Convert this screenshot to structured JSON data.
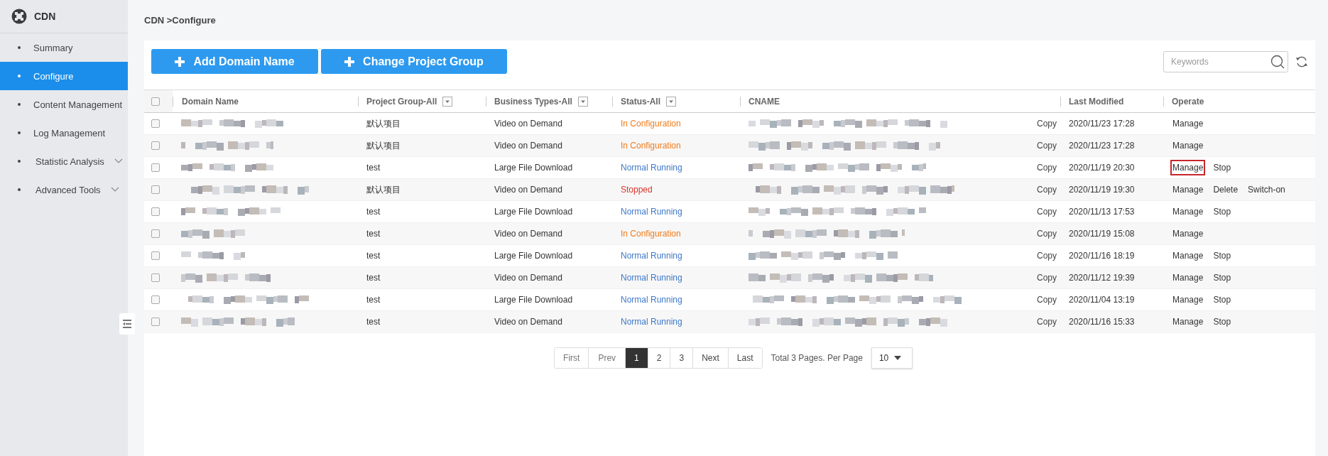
{
  "sidebar": {
    "title": "CDN",
    "items": [
      {
        "label": "Summary",
        "selected": false
      },
      {
        "label": "Configure",
        "selected": true
      },
      {
        "label": "Content Management",
        "selected": false
      },
      {
        "label": "Log Management",
        "selected": false
      },
      {
        "label": "Statistic Analysis",
        "selected": false,
        "expanded": false
      },
      {
        "label": "Advanced Tools",
        "selected": false,
        "expanded": false
      }
    ]
  },
  "breadcrumb": "CDN >Configure",
  "toolbar": {
    "buttons": [
      "Add Domain Name",
      "Change Project Group"
    ],
    "search": {
      "placeholder": "Keywords"
    }
  },
  "table": {
    "select_all_checked": false,
    "columns": [
      {
        "label": "Domain Name",
        "filter": false
      },
      {
        "label": "Project Group-All",
        "filter": true
      },
      {
        "label": "Business Types-All",
        "filter": true
      },
      {
        "label": "Status-All",
        "filter": true
      },
      {
        "label": "CNAME",
        "filter": false
      },
      {
        "label": "Last Modified",
        "filter": false
      },
      {
        "label": "Operate",
        "filter": false
      }
    ],
    "rows": [
      {
        "checked": false,
        "project": "默认项目",
        "business": "Video on Demand",
        "status": "In Configuration",
        "color": "#f07c1e",
        "copy": "Copy",
        "modified": "2020/11/23 17:28",
        "actions": [
          {
            "label": "Manage",
            "highlighted": false
          }
        ]
      },
      {
        "checked": false,
        "project": "默认项目",
        "business": "Video on Demand",
        "status": "In Configuration",
        "color": "#f07c1e",
        "copy": "Copy",
        "modified": "2020/11/23 17:28",
        "actions": [
          {
            "label": "Manage",
            "highlighted": false
          }
        ]
      },
      {
        "checked": false,
        "project": "test",
        "business": "Large File Download",
        "status": "Normal Running",
        "color": "#3e79c9",
        "copy": "Copy",
        "modified": "2020/11/19 20:30",
        "actions": [
          {
            "label": "Manage",
            "highlighted": true
          },
          {
            "label": "Stop",
            "highlighted": false
          }
        ]
      },
      {
        "checked": false,
        "project": "默认项目",
        "business": "Video on Demand",
        "status": "Stopped",
        "color": "#d9342b",
        "copy": "Copy",
        "modified": "2020/11/19 19:30",
        "actions": [
          {
            "label": "Manage",
            "highlighted": false
          },
          {
            "label": "Delete",
            "highlighted": false
          },
          {
            "label": "Switch-on",
            "highlighted": false
          }
        ]
      },
      {
        "checked": false,
        "project": "test",
        "business": "Large File Download",
        "status": "Normal Running",
        "color": "#3e79c9",
        "copy": "Copy",
        "modified": "2020/11/13 17:53",
        "actions": [
          {
            "label": "Manage",
            "highlighted": false
          },
          {
            "label": "Stop",
            "highlighted": false
          }
        ]
      },
      {
        "checked": false,
        "project": "test",
        "business": "Video on Demand",
        "status": "In Configuration",
        "color": "#f07c1e",
        "copy": "Copy",
        "modified": "2020/11/19 15:08",
        "actions": [
          {
            "label": "Manage",
            "highlighted": false
          }
        ]
      },
      {
        "checked": false,
        "project": "test",
        "business": "Large File Download",
        "status": "Normal Running",
        "color": "#3e79c9",
        "copy": "Copy",
        "modified": "2020/11/16 18:19",
        "actions": [
          {
            "label": "Manage",
            "highlighted": false
          },
          {
            "label": "Stop",
            "highlighted": false
          }
        ]
      },
      {
        "checked": false,
        "project": "test",
        "business": "Video on Demand",
        "status": "Normal Running",
        "color": "#3e79c9",
        "copy": "Copy",
        "modified": "2020/11/12 19:39",
        "actions": [
          {
            "label": "Manage",
            "highlighted": false
          },
          {
            "label": "Stop",
            "highlighted": false
          }
        ]
      },
      {
        "checked": false,
        "project": "test",
        "business": "Large File Download",
        "status": "Normal Running",
        "color": "#3e79c9",
        "copy": "Copy",
        "modified": "2020/11/04 13:19",
        "actions": [
          {
            "label": "Manage",
            "highlighted": false
          },
          {
            "label": "Stop",
            "highlighted": false
          }
        ]
      },
      {
        "checked": false,
        "project": "test",
        "business": "Video on Demand",
        "status": "Normal Running",
        "color": "#3e79c9",
        "copy": "Copy",
        "modified": "2020/11/16 15:33",
        "actions": [
          {
            "label": "Manage",
            "highlighted": false
          },
          {
            "label": "Stop",
            "highlighted": false
          }
        ]
      }
    ]
  },
  "pagination": {
    "pages": [
      {
        "label": "First",
        "selected": false
      },
      {
        "label": "Prev",
        "selected": false
      },
      {
        "label": "1",
        "selected": true
      },
      {
        "label": "2",
        "selected": false
      },
      {
        "label": "3",
        "selected": false
      },
      {
        "label": "Next",
        "selected": false
      },
      {
        "label": "Last",
        "selected": false
      }
    ],
    "summary": "Total 3 Pages. Per Page",
    "per_page": "10"
  }
}
